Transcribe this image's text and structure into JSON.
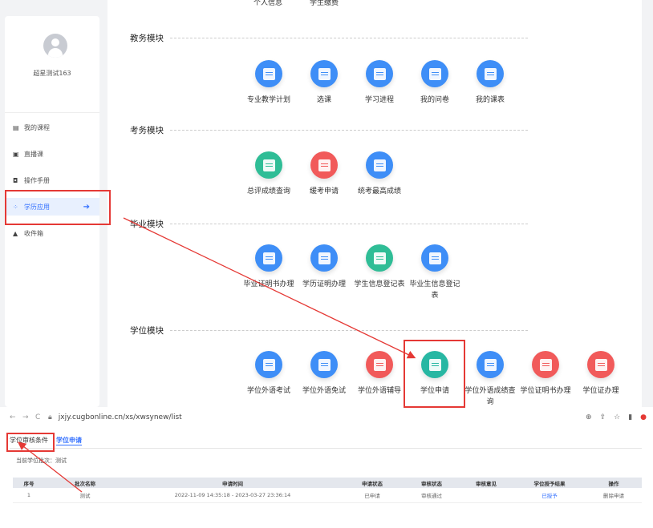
{
  "sidebar": {
    "username": "超星测试163",
    "items": [
      {
        "label": "我的课程",
        "icon": "book-icon"
      },
      {
        "label": "直播课",
        "icon": "live-icon"
      },
      {
        "label": "操作手册",
        "icon": "manual-icon"
      },
      {
        "label": "学历应用",
        "icon": "app-grid-icon"
      },
      {
        "label": "收件箱",
        "icon": "bell-icon"
      }
    ]
  },
  "top_cut": [
    "个人信息",
    "学生缴费"
  ],
  "sections": [
    {
      "title": "教务模块",
      "items": [
        {
          "label": "专业教学计划",
          "color": "blue"
        },
        {
          "label": "选课",
          "color": "blue"
        },
        {
          "label": "学习进程",
          "color": "blue"
        },
        {
          "label": "我的问卷",
          "color": "blue"
        },
        {
          "label": "我的课表",
          "color": "blue"
        }
      ]
    },
    {
      "title": "考务模块",
      "items": [
        {
          "label": "总评成绩查询",
          "color": "green"
        },
        {
          "label": "缓考申请",
          "color": "red"
        },
        {
          "label": "统考最高成绩",
          "color": "blue"
        }
      ]
    },
    {
      "title": "毕业模块",
      "items": [
        {
          "label": "毕业证明书办理",
          "color": "blue"
        },
        {
          "label": "学历证明办理",
          "color": "blue"
        },
        {
          "label": "学生信息登记表",
          "color": "green"
        },
        {
          "label": "毕业生信息登记表",
          "color": "blue"
        }
      ]
    },
    {
      "title": "学位模块",
      "items": [
        {
          "label": "学位外语考试",
          "color": "blue"
        },
        {
          "label": "学位外语免试",
          "color": "blue"
        },
        {
          "label": "学位外语辅导",
          "color": "red"
        },
        {
          "label": "学位申请",
          "color": "teal"
        },
        {
          "label": "学位外语成绩查询",
          "color": "blue"
        },
        {
          "label": "学位证明书办理",
          "color": "red"
        },
        {
          "label": "学位证办理",
          "color": "red"
        }
      ]
    }
  ],
  "browser": {
    "url": "jxjy.cugbonline.cn/xs/xwsynew/list",
    "tabs": [
      "学位审核条件",
      "学位申请"
    ],
    "subtitle": "当前学位批次：测试",
    "table": {
      "headers": [
        "序号",
        "批次名称",
        "申请时间",
        "申请状态",
        "审核状态",
        "审核意见",
        "学位授予结果",
        "操作"
      ],
      "rows": [
        [
          "1",
          "测试",
          "2022-11-09 14:35:18 - 2023-03-27 23:36:14",
          "已申请",
          "审核通过",
          "",
          "已授予",
          "删除申请"
        ]
      ]
    }
  },
  "colors": {
    "blue": "#3e8ef7",
    "red": "#f15a5a",
    "green": "#2fbd96",
    "teal": "#28b7a3",
    "annotation": "#e53935"
  }
}
